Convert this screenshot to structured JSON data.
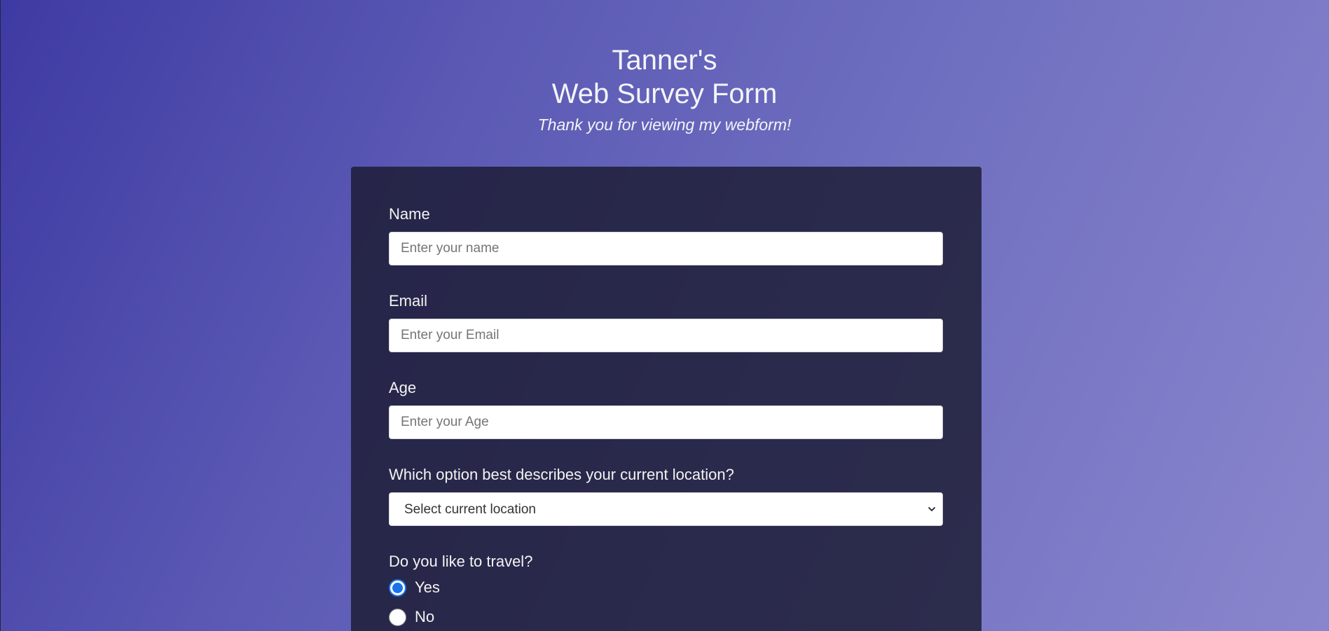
{
  "header": {
    "title_line1": "Tanner's",
    "title_line2": "Web Survey Form",
    "subtitle": "Thank you for viewing my webform!"
  },
  "form": {
    "name": {
      "label": "Name",
      "placeholder": "Enter your name",
      "value": ""
    },
    "email": {
      "label": "Email",
      "placeholder": "Enter your Email",
      "value": ""
    },
    "age": {
      "label": "Age",
      "placeholder": "Enter your Age",
      "value": ""
    },
    "location": {
      "label": "Which option best describes your current location?",
      "selected": "Select current location"
    },
    "travel": {
      "label": "Do you like to travel?",
      "options": [
        {
          "label": "Yes",
          "checked": true
        },
        {
          "label": "No",
          "checked": false
        }
      ]
    }
  },
  "colors": {
    "background_start": "#3e3aa3",
    "background_end": "#8a86cd",
    "card": "#1b1b32",
    "radio_accent": "#1a73e8"
  },
  "icons": {
    "select_arrow": "chevron-down-icon"
  }
}
